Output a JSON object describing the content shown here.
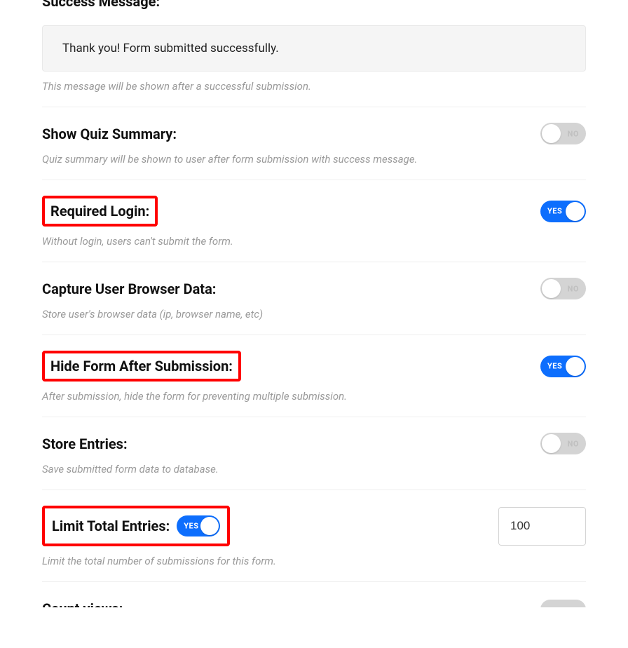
{
  "heading": "Success Message:",
  "success_message": {
    "value": "Thank you! Form submitted successfully.",
    "help": "This message will be shown after a successful submission."
  },
  "toggle_text": {
    "on": "YES",
    "off": "NO"
  },
  "settings": {
    "quiz_summary": {
      "title": "Show Quiz Summary:",
      "help": "Quiz summary will be shown to user after form submission with success message.",
      "enabled": false
    },
    "required_login": {
      "title": "Required Login:",
      "help": "Without login, users can't submit the form.",
      "enabled": true
    },
    "capture_browser": {
      "title": "Capture User Browser Data:",
      "help": "Store user's browser data (ip, browser name, etc)",
      "enabled": false
    },
    "hide_after": {
      "title": "Hide Form After Submission:",
      "help": "After submission, hide the form for preventing multiple submission.",
      "enabled": true
    },
    "store_entries": {
      "title": "Store Entries:",
      "help": "Save submitted form data to database.",
      "enabled": false
    },
    "limit_entries": {
      "title": "Limit Total Entries:",
      "help": "Limit the total number of submissions for this form.",
      "enabled": true,
      "value": "100"
    },
    "count_views": {
      "title": "Count views:",
      "enabled": false
    }
  }
}
